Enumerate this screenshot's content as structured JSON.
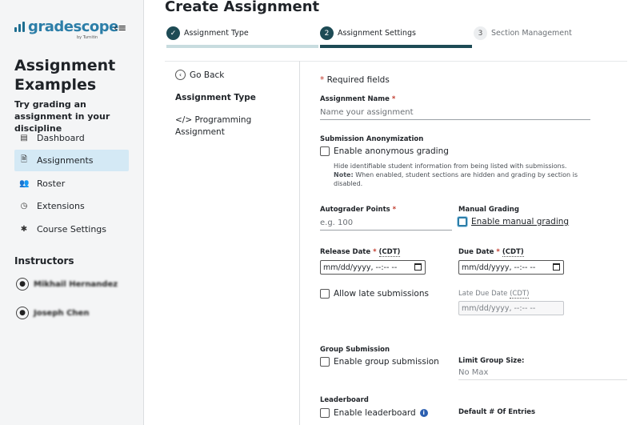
{
  "sidebar": {
    "logo_text": "gradescope",
    "logo_byline": "by Turnitin",
    "collapse_icon": "≡",
    "course_title": "Assignment Examples",
    "course_subtitle": "Try grading an assignment in your discipline",
    "nav": [
      {
        "label": "Dashboard",
        "icon": "dashboard-icon",
        "glyph": "▤",
        "active": false
      },
      {
        "label": "Assignments",
        "icon": "assignments-icon",
        "glyph": "🗎",
        "active": true
      },
      {
        "label": "Roster",
        "icon": "roster-icon",
        "glyph": "👥",
        "active": false
      },
      {
        "label": "Extensions",
        "icon": "clock-icon",
        "glyph": "◷",
        "active": false
      },
      {
        "label": "Course Settings",
        "icon": "gear-icon",
        "glyph": "✱",
        "active": false
      }
    ],
    "instructors_heading": "Instructors",
    "instructors": [
      "Mikhail Hernandez",
      "Joseph Chen"
    ]
  },
  "header": {
    "title": "Create Assignment",
    "steps": [
      {
        "number": "✓",
        "label": "Assignment Type",
        "state": "done"
      },
      {
        "number": "2",
        "label": "Assignment Settings",
        "state": "current"
      },
      {
        "number": "3",
        "label": "Section Management",
        "state": "upcoming"
      }
    ]
  },
  "left_panel": {
    "go_back": "Go Back",
    "type_heading": "Assignment Type",
    "type_value": "</> Programming Assignment"
  },
  "form": {
    "required_note": "Required fields",
    "required_mark": "*",
    "assignment_name_label": "Assignment Name",
    "assignment_name_placeholder": "Name your assignment",
    "anonymization_label": "Submission Anonymization",
    "anonymous_checkbox": "Enable anonymous grading",
    "anonymous_desc": "Hide identifiable student information from being listed with submissions.",
    "anonymous_note_label": "Note:",
    "anonymous_note": "When enabled, student sections are hidden and grading by section is disabled.",
    "autograder_label": "Autograder Points",
    "autograder_placeholder": "e.g. 100",
    "manual_grading_label": "Manual Grading",
    "manual_grading_checkbox": "Enable manual grading",
    "release_date_label": "Release Date",
    "due_date_label": "Due Date",
    "timezone": "(CDT)",
    "date_placeholder": "mm/dd/yyyy, --:-- --",
    "late_checkbox": "Allow late submissions",
    "late_due_label": "Late Due Date",
    "late_due_tz": "(CDT)",
    "group_label": "Group Submission",
    "group_checkbox": "Enable group submission",
    "limit_group_label": "Limit Group Size:",
    "limit_group_value": "No Max",
    "leaderboard_label": "Leaderboard",
    "leaderboard_checkbox": "Enable leaderboard",
    "default_entries_label": "Default # Of Entries"
  },
  "colors": {
    "accent": "#2c7ea8",
    "step_done": "#c8dcdf",
    "step_current": "#1d4b55",
    "active_nav": "#d4e9f5",
    "required": "#c0392b"
  }
}
